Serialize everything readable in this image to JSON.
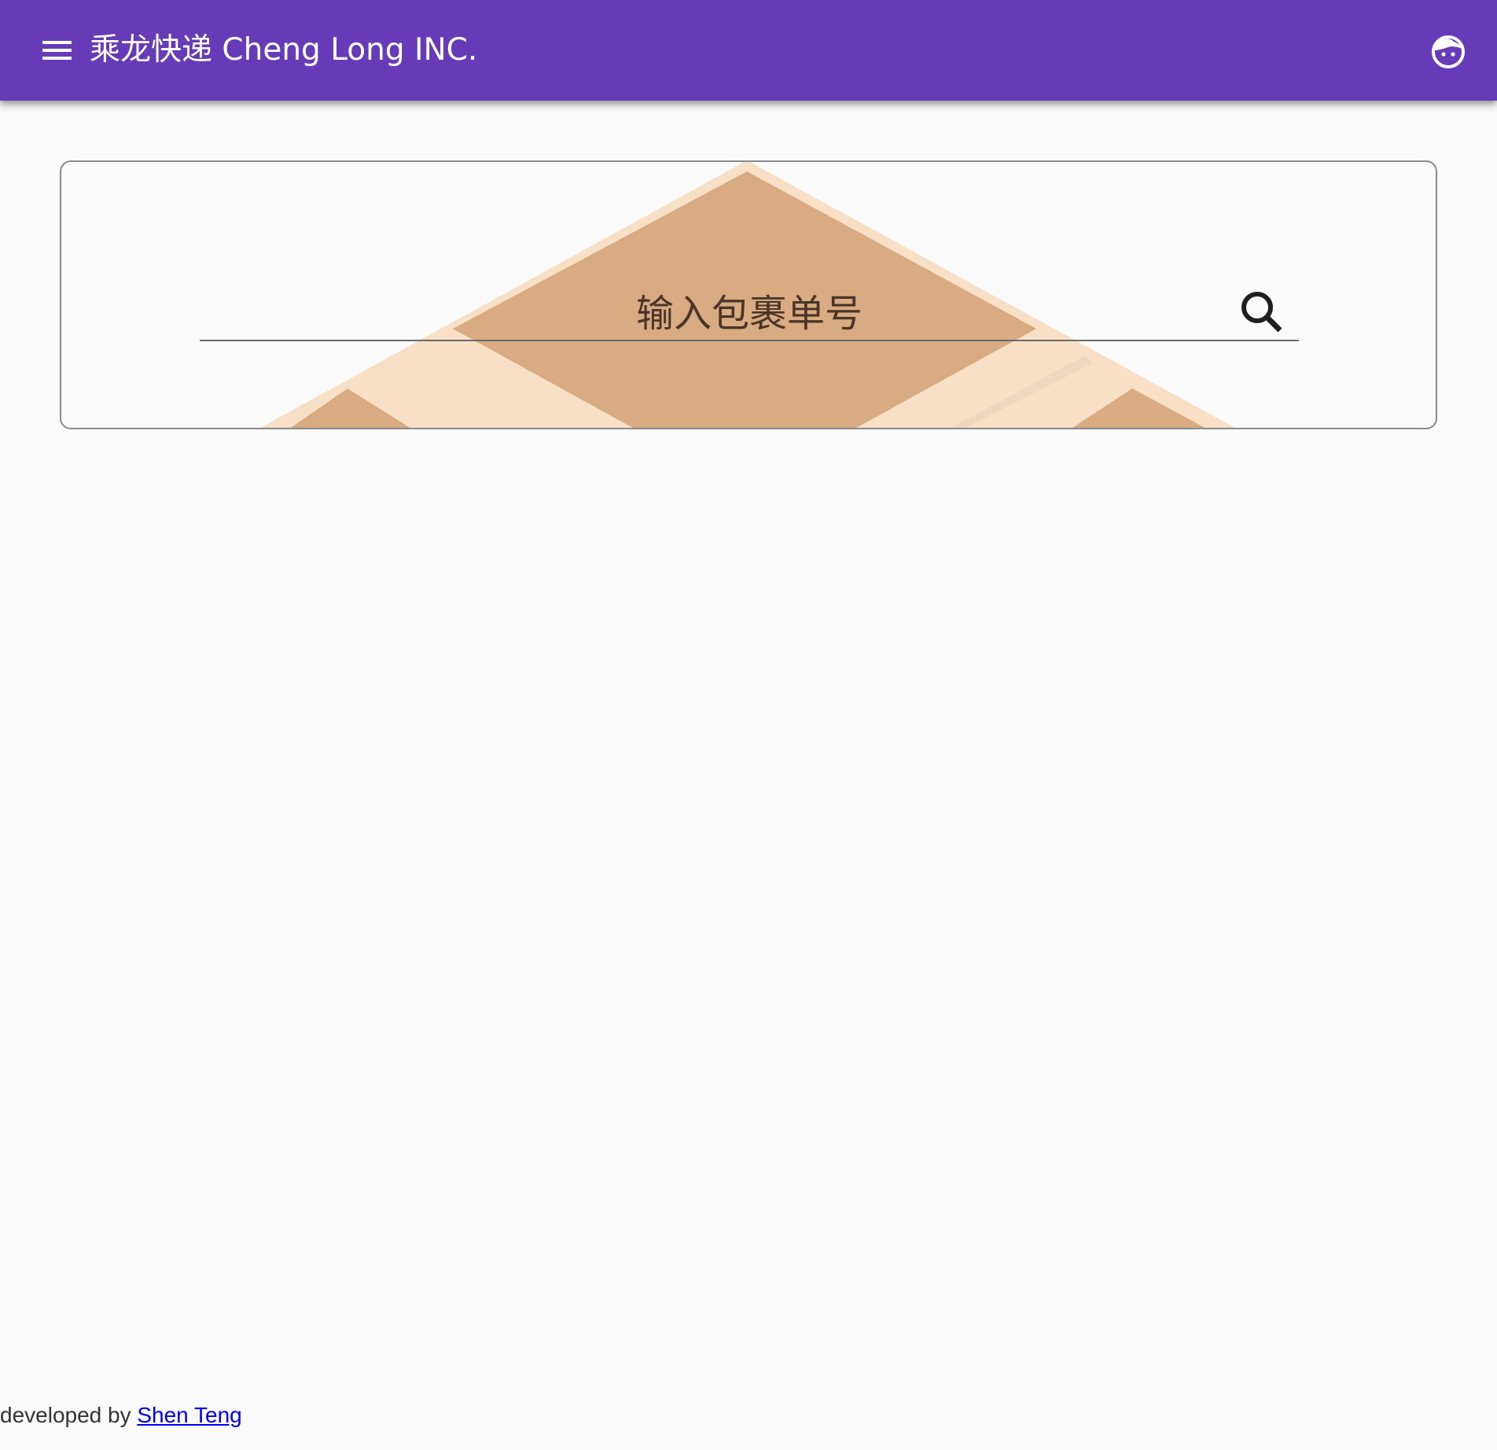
{
  "header": {
    "title": "乘龙快递 Cheng Long INC.",
    "menu_icon": "menu-icon",
    "avatar_icon": "face-icon",
    "background_color": "#673ab7",
    "text_color": "#ffffff"
  },
  "search": {
    "placeholder": "输入包裹单号",
    "value": "",
    "button_icon": "search-icon",
    "art_colors": {
      "box_dark": "#d9ab82",
      "box_light": "#f8e0c6"
    }
  },
  "footer": {
    "prefix": "developed by",
    "author_link": "Shen Teng"
  }
}
